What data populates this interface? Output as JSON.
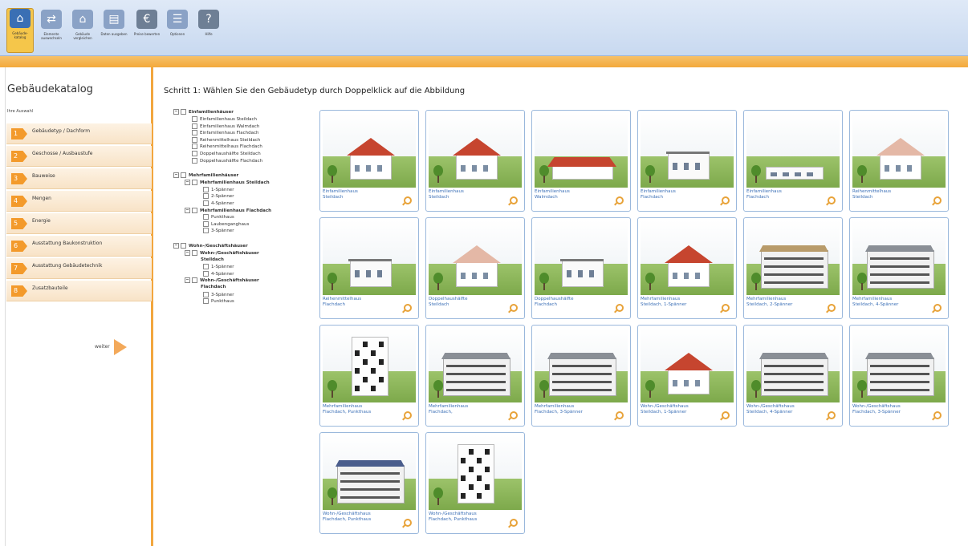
{
  "ribbon": {
    "buttons": [
      {
        "label": "Gebäude-katalog",
        "icon": "building-catalog-icon",
        "color": "#3a6fb4",
        "active": true
      },
      {
        "label": "Elemente auswechseln",
        "icon": "swap-elements-icon",
        "color": "#8aa2c6"
      },
      {
        "label": "Gebäude vergleichen",
        "icon": "compare-buildings-icon",
        "color": "#8aa2c6"
      },
      {
        "label": "Daten ausgeben",
        "icon": "export-data-icon",
        "color": "#8aa2c6"
      },
      {
        "label": "Preise bewerten",
        "icon": "euro-price-icon",
        "color": "#6e7f95"
      },
      {
        "label": "Optionen",
        "icon": "options-icon",
        "color": "#8aa2c6"
      },
      {
        "label": "Hilfe",
        "icon": "help-icon",
        "color": "#6e7f95"
      }
    ]
  },
  "sidebar": {
    "title": "Gebäudekatalog",
    "subtitle": "Ihre Auswahl",
    "steps": [
      {
        "num": "1",
        "label": "Gebäudetyp / Dachform"
      },
      {
        "num": "2",
        "label": "Geschosse / Ausbaustufe"
      },
      {
        "num": "3",
        "label": "Bauweise"
      },
      {
        "num": "4",
        "label": "Mengen"
      },
      {
        "num": "5",
        "label": "Energie"
      },
      {
        "num": "6",
        "label": "Ausstattung Baukonstruktion"
      },
      {
        "num": "7",
        "label": "Ausstattung Gebäudetechnik"
      },
      {
        "num": "8",
        "label": "Zusatzbauteile"
      }
    ],
    "next_label": "weiter"
  },
  "main": {
    "title": "Schritt 1: Wählen Sie den Gebäudetyp durch Doppelklick auf die Abbildung"
  },
  "tree": [
    {
      "label": "Einfamilienhäuser",
      "bold": true,
      "toggle": "⊟",
      "level": 0
    },
    {
      "label": "Einfamilienhaus Steildach",
      "level": 1
    },
    {
      "label": "Einfamilienhaus Walmdach",
      "level": 1
    },
    {
      "label": "Einfamilienhaus Flachdach",
      "level": 1
    },
    {
      "label": "Reihenmittelhaus Steildach",
      "level": 1
    },
    {
      "label": "Reihenmittelhaus Flachdach",
      "level": 1
    },
    {
      "label": "Doppelhaushälfte Steildach",
      "level": 1
    },
    {
      "label": "Doppelhaushälfte Flachdach",
      "level": 1
    },
    {
      "label": "Mehrfamilienhäuser",
      "bold": true,
      "toggle": "⊟",
      "level": 0,
      "gap": true
    },
    {
      "label": "Mehrfamilienhaus Steildach",
      "bold": true,
      "toggle": "⊟",
      "level": 1
    },
    {
      "label": "1-Spänner",
      "level": 2
    },
    {
      "label": "2-Spänner",
      "level": 2
    },
    {
      "label": "4-Spänner",
      "level": 2
    },
    {
      "label": "Mehrfamilienhaus Flachdach",
      "bold": true,
      "toggle": "⊟",
      "level": 1
    },
    {
      "label": "Punkthaus",
      "level": 2
    },
    {
      "label": "Laubenganghaus",
      "level": 2
    },
    {
      "label": "3-Spänner",
      "level": 2
    },
    {
      "label": "Wohn-/Geschäftshäuser",
      "bold": true,
      "toggle": "⊟",
      "level": 0,
      "gap": true
    },
    {
      "label": "Wohn-/Geschäftshäuser",
      "bold": true,
      "toggle": "⊟",
      "level": 1
    },
    {
      "label": "Steildach",
      "bold": true,
      "level": 1,
      "cont": true
    },
    {
      "label": "1-Spänner",
      "level": 2
    },
    {
      "label": "4-Spänner",
      "level": 2
    },
    {
      "label": "Wohn-/Geschäftshäuser",
      "bold": true,
      "toggle": "⊟",
      "level": 1
    },
    {
      "label": "Flachdach",
      "bold": true,
      "level": 1,
      "cont": true
    },
    {
      "label": "3-Spänner",
      "level": 2
    },
    {
      "label": "Punkthaus",
      "level": 2
    }
  ],
  "tiles": [
    {
      "line1": "Einfamilienhaus",
      "line2": "Steildach",
      "style": "red-gable"
    },
    {
      "line1": "Einfamilienhaus",
      "line2": "Steildach",
      "style": "red-gable"
    },
    {
      "line1": "Einfamilienhaus",
      "line2": "Walmdach",
      "style": "red-hip"
    },
    {
      "line1": "Einfamilienhaus",
      "line2": "Flachdach",
      "style": "flat-small"
    },
    {
      "line1": "Einfamilienhaus",
      "line2": "Flachdach",
      "style": "flat-long"
    },
    {
      "line1": "Reihenmittelhaus",
      "line2": "Steildach",
      "style": "pale-gable"
    },
    {
      "line1": "Reihenmittelhaus",
      "line2": "Flachdach",
      "style": "pale-flat"
    },
    {
      "line1": "Doppelhaushälfte",
      "line2": "Steildach",
      "style": "pale-gable"
    },
    {
      "line1": "Doppelhaushälfte",
      "line2": "Flachdach",
      "style": "pale-flat"
    },
    {
      "line1": "Mehrfamilienhaus",
      "line2": "Steildach, 1-Spänner",
      "style": "red-gable"
    },
    {
      "line1": "Mehrfamilienhaus",
      "line2": "Steildach, 2-Spänner",
      "style": "block-wood"
    },
    {
      "line1": "Mehrfamilienhaus",
      "line2": "Steildach, 4-Spänner",
      "style": "block-grey"
    },
    {
      "line1": "Mehrfamilienhaus",
      "line2": "Flachdach, Punkthaus",
      "style": "tower"
    },
    {
      "line1": "Mehrfamilienhaus",
      "line2": "Flachdach,",
      "style": "block-long"
    },
    {
      "line1": "Mehrfamilienhaus",
      "line2": "Flachdach, 3-Spänner",
      "style": "block-grey"
    },
    {
      "line1": "Wohn-/Geschäftshaus",
      "line2": "Steildach, 1-Spänner",
      "style": "red-gable"
    },
    {
      "line1": "Wohn-/Geschäftshaus",
      "line2": "Steildach, 4-Spänner",
      "style": "block-grey"
    },
    {
      "line1": "Wohn-/Geschäftshaus",
      "line2": "Flachdach, 3-Spänner",
      "style": "block-grey"
    },
    {
      "line1": "Wohn-/Geschäftshaus",
      "line2": "Flachdach, Punkthaus",
      "style": "block-blue"
    },
    {
      "line1": "Wohn-/Geschäftshaus",
      "line2": "Flachdach, Punkthaus",
      "style": "tower"
    }
  ]
}
